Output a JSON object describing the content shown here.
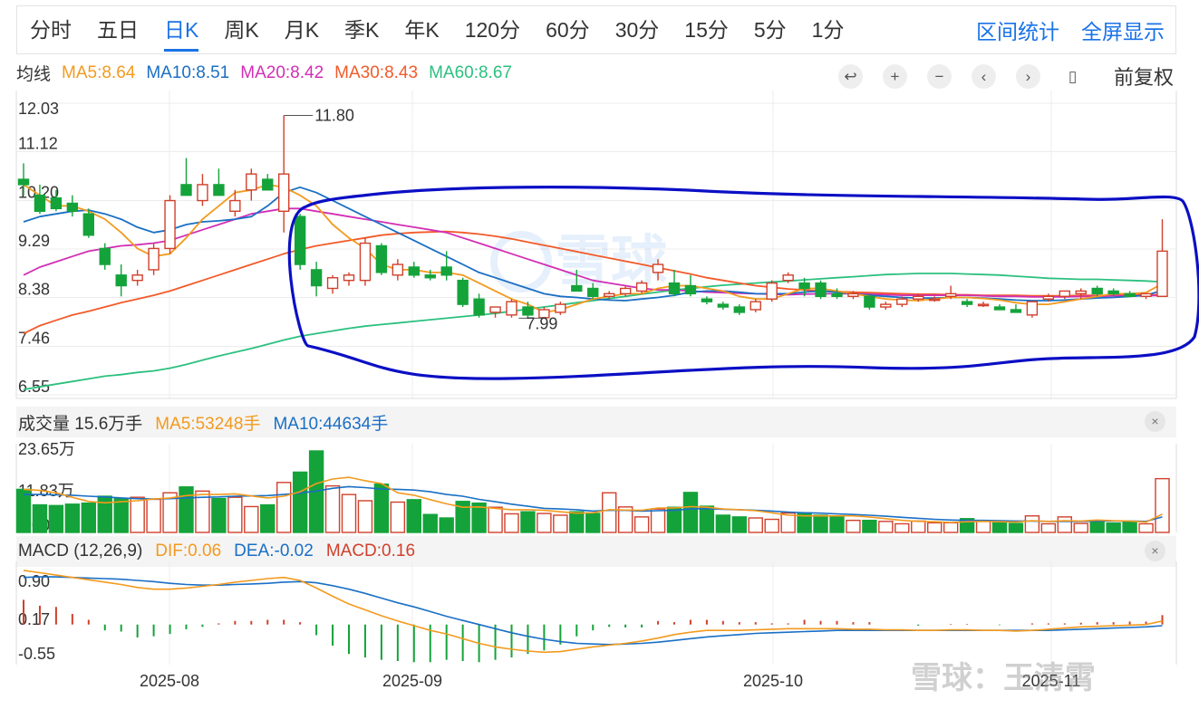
{
  "tabs": [
    "分时",
    "五日",
    "日K",
    "周K",
    "月K",
    "季K",
    "年K",
    "120分",
    "60分",
    "30分",
    "15分",
    "5分",
    "1分"
  ],
  "active_tab": "日K",
  "links": {
    "interval_stats": "区间统计",
    "fullscreen": "全屏显示"
  },
  "ma_legend": {
    "label": "均线",
    "items": [
      {
        "text": "MA5:8.64",
        "color": "#f39a1e"
      },
      {
        "text": "MA10:8.51",
        "color": "#1a6fc4"
      },
      {
        "text": "MA20:8.42",
        "color": "#d12fb5"
      },
      {
        "text": "MA30:8.43",
        "color": "#f25a2a"
      },
      {
        "text": "MA60:8.67",
        "color": "#2cc07f"
      }
    ]
  },
  "controls": {
    "icons": [
      "undo-icon",
      "zoom-in-icon",
      "zoom-out-icon",
      "arrow-left-icon",
      "arrow-right-icon",
      "candle-type-icon"
    ],
    "glyphs": [
      "↩",
      "+",
      "−",
      "‹",
      "›",
      "▯"
    ],
    "adjust": "前复权"
  },
  "volume_legend": {
    "label": "成交量 15.6万手",
    "items": [
      {
        "text": "MA5:53248手",
        "color": "#f39a1e"
      },
      {
        "text": "MA10:44634手",
        "color": "#1a6fc4"
      }
    ]
  },
  "macd_legend": {
    "label": "MACD (12,26,9)",
    "items": [
      {
        "text": "DIF:0.06",
        "color": "#f39a1e"
      },
      {
        "text": "DEA:-0.02",
        "color": "#1a6fc4"
      },
      {
        "text": "MACD:0.16",
        "color": "#d0402b"
      }
    ]
  },
  "close_glyph": "×",
  "watermark": {
    "center": "雪球",
    "corner": "雪球：王清霄"
  },
  "colors": {
    "up": "#d0402b",
    "down": "#14a33a",
    "grid": "#ececec",
    "annotation": "#0b0fc4"
  },
  "chart_data": [
    {
      "type": "candlestick",
      "title": "",
      "y_ticks": [
        "12.03",
        "11.12",
        "10.20",
        "9.29",
        "8.38",
        "7.46",
        "6.55"
      ],
      "ylim": [
        6.55,
        12.03
      ],
      "x_tick_labels": [
        "2025-08",
        "2025-09",
        "2025-10",
        "2025-11"
      ],
      "annotations": [
        {
          "text": "11.80",
          "value": 11.8
        },
        {
          "text": "7.99",
          "value": 7.99
        }
      ],
      "ohlc": [
        [
          10.6,
          10.9,
          10.3,
          10.5
        ],
        [
          10.3,
          10.5,
          9.95,
          10.0
        ],
        [
          10.25,
          10.4,
          10.0,
          10.05
        ],
        [
          10.15,
          10.3,
          9.9,
          10.0
        ],
        [
          9.95,
          10.05,
          9.5,
          9.55
        ],
        [
          9.3,
          9.4,
          8.9,
          9.0
        ],
        [
          8.8,
          9.0,
          8.4,
          8.6
        ],
        [
          8.7,
          8.9,
          8.6,
          8.8
        ],
        [
          8.9,
          9.4,
          8.8,
          9.3
        ],
        [
          9.3,
          10.3,
          9.2,
          10.2
        ],
        [
          10.5,
          11.0,
          10.3,
          10.3
        ],
        [
          10.2,
          10.7,
          10.1,
          10.5
        ],
        [
          10.5,
          10.8,
          10.3,
          10.3
        ],
        [
          10.0,
          10.4,
          9.9,
          10.2
        ],
        [
          10.4,
          10.8,
          10.2,
          10.7
        ],
        [
          10.6,
          10.7,
          10.4,
          10.4
        ],
        [
          10.0,
          11.8,
          9.6,
          10.7
        ],
        [
          9.9,
          9.95,
          8.9,
          9.0
        ],
        [
          8.9,
          9.05,
          8.4,
          8.6
        ],
        [
          8.55,
          8.8,
          8.45,
          8.75
        ],
        [
          8.7,
          8.85,
          8.6,
          8.8
        ],
        [
          8.7,
          9.5,
          8.6,
          9.4
        ],
        [
          9.35,
          9.4,
          8.8,
          8.85
        ],
        [
          8.8,
          9.1,
          8.7,
          9.0
        ],
        [
          8.95,
          9.05,
          8.75,
          8.8
        ],
        [
          8.8,
          8.9,
          8.7,
          8.75
        ],
        [
          8.95,
          9.25,
          8.7,
          8.8
        ],
        [
          8.7,
          8.75,
          8.2,
          8.25
        ],
        [
          8.35,
          8.45,
          8.0,
          8.05
        ],
        [
          8.1,
          8.2,
          8.0,
          8.2
        ],
        [
          8.05,
          8.35,
          8.0,
          8.3
        ],
        [
          8.2,
          8.3,
          8.0,
          8.05
        ],
        [
          8.0,
          8.2,
          7.99,
          8.15
        ],
        [
          8.1,
          8.3,
          8.05,
          8.25
        ],
        [
          8.6,
          8.9,
          8.5,
          8.5
        ],
        [
          8.55,
          8.65,
          8.35,
          8.4
        ],
        [
          8.4,
          8.5,
          8.35,
          8.45
        ],
        [
          8.45,
          8.6,
          8.4,
          8.55
        ],
        [
          8.5,
          8.7,
          8.45,
          8.65
        ],
        [
          8.85,
          9.1,
          8.7,
          9.0
        ],
        [
          8.65,
          8.9,
          8.4,
          8.45
        ],
        [
          8.6,
          8.8,
          8.4,
          8.45
        ],
        [
          8.35,
          8.4,
          8.25,
          8.3
        ],
        [
          8.25,
          8.3,
          8.15,
          8.2
        ],
        [
          8.2,
          8.25,
          8.05,
          8.1
        ],
        [
          8.15,
          8.35,
          8.1,
          8.3
        ],
        [
          8.35,
          8.7,
          8.3,
          8.65
        ],
        [
          8.7,
          8.85,
          8.65,
          8.8
        ],
        [
          8.65,
          8.75,
          8.4,
          8.55
        ],
        [
          8.65,
          8.7,
          8.35,
          8.4
        ],
        [
          8.45,
          8.55,
          8.35,
          8.4
        ],
        [
          8.4,
          8.5,
          8.35,
          8.45
        ],
        [
          8.4,
          8.45,
          8.15,
          8.2
        ],
        [
          8.2,
          8.3,
          8.15,
          8.25
        ],
        [
          8.25,
          8.4,
          8.2,
          8.35
        ],
        [
          8.35,
          8.45,
          8.3,
          8.4
        ],
        [
          8.35,
          8.4,
          8.3,
          8.35
        ],
        [
          8.4,
          8.6,
          8.35,
          8.45
        ],
        [
          8.3,
          8.35,
          8.2,
          8.25
        ],
        [
          8.25,
          8.3,
          8.2,
          8.25
        ],
        [
          8.2,
          8.25,
          8.15,
          8.15
        ],
        [
          8.15,
          8.25,
          8.1,
          8.1
        ],
        [
          8.05,
          8.3,
          8.0,
          8.3
        ],
        [
          8.35,
          8.45,
          8.3,
          8.4
        ],
        [
          8.4,
          8.5,
          8.35,
          8.5
        ],
        [
          8.45,
          8.55,
          8.35,
          8.5
        ],
        [
          8.55,
          8.6,
          8.4,
          8.45
        ],
        [
          8.5,
          8.55,
          8.4,
          8.45
        ],
        [
          8.45,
          8.5,
          8.4,
          8.4
        ],
        [
          8.4,
          8.45,
          8.35,
          8.45
        ],
        [
          8.4,
          9.85,
          8.4,
          9.25
        ]
      ],
      "ma5": [
        10.5,
        10.3,
        10.1,
        10.1,
        10.0,
        9.85,
        9.6,
        9.3,
        9.15,
        9.2,
        9.5,
        9.85,
        10.1,
        10.35,
        10.4,
        10.5,
        10.45,
        10.3,
        10.1,
        9.75,
        9.5,
        9.3,
        9.0,
        8.9,
        8.9,
        8.85,
        8.85,
        8.8,
        8.65,
        8.5,
        8.35,
        8.25,
        8.1,
        8.15,
        8.25,
        8.35,
        8.4,
        8.45,
        8.45,
        8.55,
        8.6,
        8.6,
        8.55,
        8.5,
        8.4,
        8.35,
        8.35,
        8.45,
        8.55,
        8.55,
        8.5,
        8.45,
        8.4,
        8.35,
        8.33,
        8.32,
        8.35,
        8.38,
        8.38,
        8.36,
        8.33,
        8.28,
        8.25,
        8.25,
        8.3,
        8.35,
        8.4,
        8.45,
        8.45,
        8.47,
        8.64
      ],
      "ma10": [
        9.8,
        9.9,
        9.95,
        10.0,
        10.02,
        9.95,
        9.85,
        9.7,
        9.6,
        9.65,
        9.75,
        9.8,
        9.82,
        9.85,
        9.9,
        10.1,
        10.35,
        10.45,
        10.35,
        10.2,
        10.05,
        9.9,
        9.75,
        9.6,
        9.45,
        9.3,
        9.15,
        9.0,
        8.85,
        8.75,
        8.65,
        8.55,
        8.45,
        8.4,
        8.38,
        8.35,
        8.33,
        8.32,
        8.35,
        8.38,
        8.42,
        8.48,
        8.5,
        8.5,
        8.48,
        8.45,
        8.45,
        8.45,
        8.48,
        8.5,
        8.48,
        8.45,
        8.42,
        8.4,
        8.38,
        8.37,
        8.37,
        8.38,
        8.38,
        8.37,
        8.35,
        8.33,
        8.32,
        8.32,
        8.33,
        8.35,
        8.37,
        8.38,
        8.4,
        8.42,
        8.51
      ],
      "ma20": [
        8.8,
        8.95,
        9.05,
        9.15,
        9.25,
        9.3,
        9.35,
        9.37,
        9.4,
        9.45,
        9.55,
        9.65,
        9.75,
        9.85,
        9.95,
        10.0,
        10.05,
        10.05,
        10.0,
        9.95,
        9.9,
        9.85,
        9.8,
        9.75,
        9.7,
        9.65,
        9.6,
        9.5,
        9.4,
        9.3,
        9.2,
        9.1,
        9.0,
        8.9,
        8.8,
        8.7,
        8.65,
        8.6,
        8.55,
        8.52,
        8.52,
        8.5,
        8.48,
        8.47,
        8.46,
        8.45,
        8.44,
        8.43,
        8.44,
        8.45,
        8.45,
        8.45,
        8.44,
        8.43,
        8.42,
        8.42,
        8.42,
        8.42,
        8.42,
        8.41,
        8.4,
        8.4,
        8.39,
        8.39,
        8.39,
        8.4,
        8.4,
        8.41,
        8.41,
        8.41,
        8.42
      ],
      "ma30": [
        7.7,
        7.85,
        7.95,
        8.05,
        8.12,
        8.2,
        8.28,
        8.35,
        8.42,
        8.5,
        8.6,
        8.7,
        8.8,
        8.9,
        9.0,
        9.1,
        9.2,
        9.28,
        9.35,
        9.4,
        9.45,
        9.5,
        9.55,
        9.58,
        9.6,
        9.61,
        9.62,
        9.6,
        9.57,
        9.53,
        9.48,
        9.42,
        9.36,
        9.3,
        9.24,
        9.18,
        9.12,
        9.06,
        9.0,
        8.94,
        8.88,
        8.82,
        8.75,
        8.7,
        8.65,
        8.6,
        8.57,
        8.54,
        8.52,
        8.5,
        8.49,
        8.48,
        8.47,
        8.46,
        8.45,
        8.44,
        8.44,
        8.43,
        8.43,
        8.42,
        8.42,
        8.42,
        8.41,
        8.41,
        8.41,
        8.42,
        8.42,
        8.42,
        8.43,
        8.43,
        8.43
      ],
      "ma60": [
        6.65,
        6.7,
        6.75,
        6.8,
        6.85,
        6.9,
        6.93,
        6.97,
        7.0,
        7.05,
        7.12,
        7.2,
        7.28,
        7.35,
        7.42,
        7.5,
        7.58,
        7.65,
        7.7,
        7.75,
        7.8,
        7.84,
        7.87,
        7.9,
        7.93,
        7.96,
        7.99,
        8.02,
        8.05,
        8.08,
        8.12,
        8.16,
        8.2,
        8.24,
        8.28,
        8.32,
        8.36,
        8.4,
        8.44,
        8.48,
        8.52,
        8.55,
        8.58,
        8.61,
        8.63,
        8.65,
        8.67,
        8.69,
        8.71,
        8.73,
        8.75,
        8.77,
        8.79,
        8.81,
        8.82,
        8.83,
        8.83,
        8.83,
        8.82,
        8.81,
        8.8,
        8.78,
        8.76,
        8.74,
        8.73,
        8.72,
        8.72,
        8.71,
        8.7,
        8.69,
        8.67
      ]
    },
    {
      "type": "bar",
      "title": "",
      "y_ticks": [
        "23.65万",
        "11.83万",
        "0.00"
      ],
      "ylim": [
        0,
        23.65
      ],
      "unit": "万手",
      "values": [
        12.5,
        8.0,
        7.8,
        8.2,
        8.5,
        10.5,
        9.8,
        10.2,
        9.6,
        11.5,
        13.2,
        12.0,
        9.8,
        10.2,
        7.5,
        8.0,
        14.5,
        17.5,
        23.65,
        13.5,
        11.0,
        9.2,
        14.0,
        8.8,
        9.5,
        5.2,
        4.2,
        9.0,
        8.5,
        7.3,
        5.4,
        6.0,
        5.5,
        5.0,
        6.0,
        5.5,
        11.5,
        7.4,
        4.5,
        6.8,
        7.3,
        11.6,
        7.6,
        5.0,
        4.5,
        4.2,
        3.8,
        5.6,
        5.7,
        5.0,
        4.8,
        3.5,
        3.5,
        3.2,
        2.5,
        3.3,
        2.8,
        2.8,
        4.0,
        3.2,
        2.8,
        2.6,
        4.8,
        2.5,
        4.5,
        2.6,
        3.5,
        2.7,
        3.0,
        2.5,
        15.6
      ],
      "ma5": [
        12.5,
        12.2,
        11.5,
        10.2,
        9.0,
        8.6,
        8.9,
        9.2,
        9.7,
        10.0,
        10.7,
        11.0,
        11.0,
        11.2,
        10.6,
        10.0,
        10.5,
        11.8,
        14.2,
        15.5,
        16.0,
        15.0,
        14.2,
        11.5,
        10.8,
        9.5,
        8.3,
        7.3,
        7.4,
        7.0,
        6.6,
        6.6,
        6.4,
        6.0,
        5.6,
        5.7,
        6.6,
        6.5,
        6.4,
        7.1,
        7.1,
        7.5,
        7.3,
        6.8,
        6.6,
        6.3,
        5.7,
        5.0,
        4.8,
        4.8,
        4.8,
        4.8,
        4.5,
        4.0,
        3.5,
        3.2,
        3.1,
        2.9,
        3.1,
        3.2,
        3.1,
        3.0,
        3.4,
        3.2,
        3.4,
        3.3,
        3.6,
        3.4,
        3.3,
        3.0,
        5.3
      ],
      "ma10": [
        11.0,
        11.0,
        10.9,
        10.8,
        10.5,
        10.3,
        10.0,
        9.8,
        9.7,
        9.8,
        10.0,
        10.2,
        10.3,
        10.5,
        10.6,
        10.7,
        11.0,
        11.4,
        12.0,
        12.8,
        13.3,
        13.0,
        12.6,
        12.5,
        12.3,
        11.8,
        11.0,
        10.5,
        9.6,
        8.9,
        8.2,
        7.6,
        7.0,
        6.8,
        6.6,
        6.2,
        6.4,
        6.4,
        6.2,
        6.3,
        6.4,
        6.8,
        6.9,
        6.7,
        6.6,
        6.4,
        6.2,
        5.9,
        5.7,
        5.6,
        5.4,
        5.2,
        5.0,
        4.7,
        4.4,
        4.1,
        3.8,
        3.6,
        3.5,
        3.5,
        3.4,
        3.3,
        3.3,
        3.2,
        3.2,
        3.2,
        3.3,
        3.3,
        3.3,
        3.2,
        4.5
      ]
    },
    {
      "type": "bar",
      "title": "",
      "y_ticks": [
        "0.90",
        "0.17",
        "-0.55"
      ],
      "ylim": [
        -0.62,
        0.95
      ],
      "dif": [
        0.92,
        0.88,
        0.84,
        0.8,
        0.76,
        0.72,
        0.68,
        0.63,
        0.6,
        0.6,
        0.62,
        0.65,
        0.68,
        0.72,
        0.75,
        0.78,
        0.8,
        0.75,
        0.62,
        0.48,
        0.35,
        0.25,
        0.15,
        0.06,
        -0.02,
        -0.1,
        -0.16,
        -0.24,
        -0.32,
        -0.38,
        -0.42,
        -0.45,
        -0.47,
        -0.46,
        -0.42,
        -0.38,
        -0.35,
        -0.32,
        -0.28,
        -0.23,
        -0.17,
        -0.13,
        -0.1,
        -0.1,
        -0.1,
        -0.09,
        -0.08,
        -0.07,
        -0.07,
        -0.07,
        -0.07,
        -0.08,
        -0.08,
        -0.09,
        -0.09,
        -0.1,
        -0.1,
        -0.09,
        -0.09,
        -0.1,
        -0.1,
        -0.11,
        -0.1,
        -0.08,
        -0.06,
        -0.04,
        -0.03,
        -0.02,
        -0.01,
        0.0,
        0.06
      ],
      "dea": [
        0.8,
        0.81,
        0.81,
        0.8,
        0.79,
        0.78,
        0.77,
        0.75,
        0.73,
        0.7,
        0.68,
        0.67,
        0.67,
        0.68,
        0.69,
        0.7,
        0.72,
        0.73,
        0.71,
        0.66,
        0.6,
        0.53,
        0.45,
        0.37,
        0.3,
        0.22,
        0.14,
        0.07,
        0.0,
        -0.07,
        -0.14,
        -0.2,
        -0.25,
        -0.29,
        -0.32,
        -0.33,
        -0.34,
        -0.33,
        -0.32,
        -0.3,
        -0.27,
        -0.24,
        -0.21,
        -0.19,
        -0.17,
        -0.15,
        -0.14,
        -0.13,
        -0.12,
        -0.11,
        -0.1,
        -0.1,
        -0.1,
        -0.1,
        -0.1,
        -0.1,
        -0.1,
        -0.1,
        -0.1,
        -0.1,
        -0.1,
        -0.1,
        -0.1,
        -0.1,
        -0.09,
        -0.08,
        -0.07,
        -0.06,
        -0.05,
        -0.04,
        -0.02
      ],
      "macd": [
        0.42,
        0.32,
        0.3,
        0.18,
        0.08,
        -0.1,
        -0.12,
        -0.22,
        -0.2,
        -0.16,
        -0.08,
        -0.04,
        0.02,
        0.06,
        0.06,
        0.08,
        0.08,
        0.04,
        -0.18,
        -0.36,
        -0.5,
        -0.56,
        -0.6,
        -0.62,
        -0.64,
        -0.64,
        -0.6,
        -0.62,
        -0.64,
        -0.6,
        -0.56,
        -0.5,
        -0.44,
        -0.34,
        -0.2,
        -0.1,
        -0.04,
        -0.05,
        -0.05,
        0.06,
        0.04,
        0.08,
        0.08,
        0.06,
        0.04,
        0.04,
        0.02,
        0.02,
        0.08,
        0.06,
        0.06,
        0.04,
        0.04,
        0.0,
        0.0,
        -0.02,
        0.0,
        0.01,
        0.01,
        0.0,
        -0.01,
        0.0,
        0.02,
        0.02,
        0.02,
        0.03,
        0.04,
        0.04,
        0.05,
        0.05,
        0.16
      ]
    }
  ]
}
